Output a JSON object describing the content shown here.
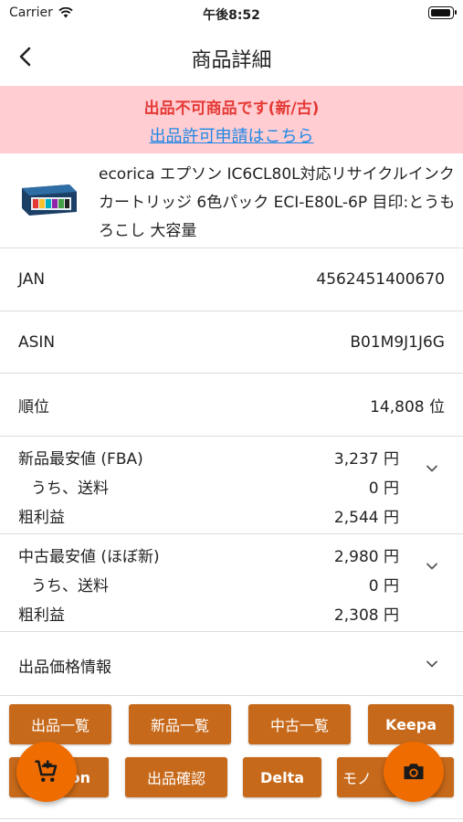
{
  "status_bar": {
    "carrier": "Carrier",
    "time": "午後8:52",
    "battery_level": 0.95
  },
  "nav": {
    "title": "商品詳細",
    "back_icon": "chevron-left-icon"
  },
  "alert": {
    "title": "出品不可商品です(新/古)",
    "link": "出品許可申請はこちら",
    "background": "#ffcdd2",
    "title_color": "#e53935",
    "link_color": "#1e88e5"
  },
  "product": {
    "name": "ecorica エプソン IC6CL80L対応リサイクルインクカートリッジ 6色パック ECI-E80L-6P 目印:とうもろこし 大容量"
  },
  "info_rows": [
    {
      "label": "JAN",
      "value": "4562451400670"
    },
    {
      "label": "ASIN",
      "value": "B01M9J1J6G"
    },
    {
      "label": "順位",
      "value": "14,808 位"
    }
  ],
  "new_price": {
    "label": "新品最安値 (FBA)",
    "price": "3,237 円",
    "shipping_label": "うち、送料",
    "shipping": "0 円",
    "profit_label": "粗利益",
    "profit": "2,544 円"
  },
  "used_price": {
    "label": "中古最安値 (ほぼ新)",
    "price": "2,980 円",
    "shipping_label": "うち、送料",
    "shipping": "0 円",
    "profit_label": "粗利益",
    "profit": "2,308 円"
  },
  "listing_info": {
    "label": "出品価格情報"
  },
  "buttons": {
    "listing_list": "出品一覧",
    "new_list": "新品一覧",
    "used_list": "中古一覧",
    "keepa": "Keepa",
    "amazon_partial": "on",
    "listing_check": "出品確認",
    "delta": "Delta",
    "mono_partial": "モノ",
    "color": "#c7691a"
  },
  "fab": {
    "cart_icon": "cart-plus-icon",
    "camera_icon": "camera-icon",
    "color": "#ef6c00"
  }
}
